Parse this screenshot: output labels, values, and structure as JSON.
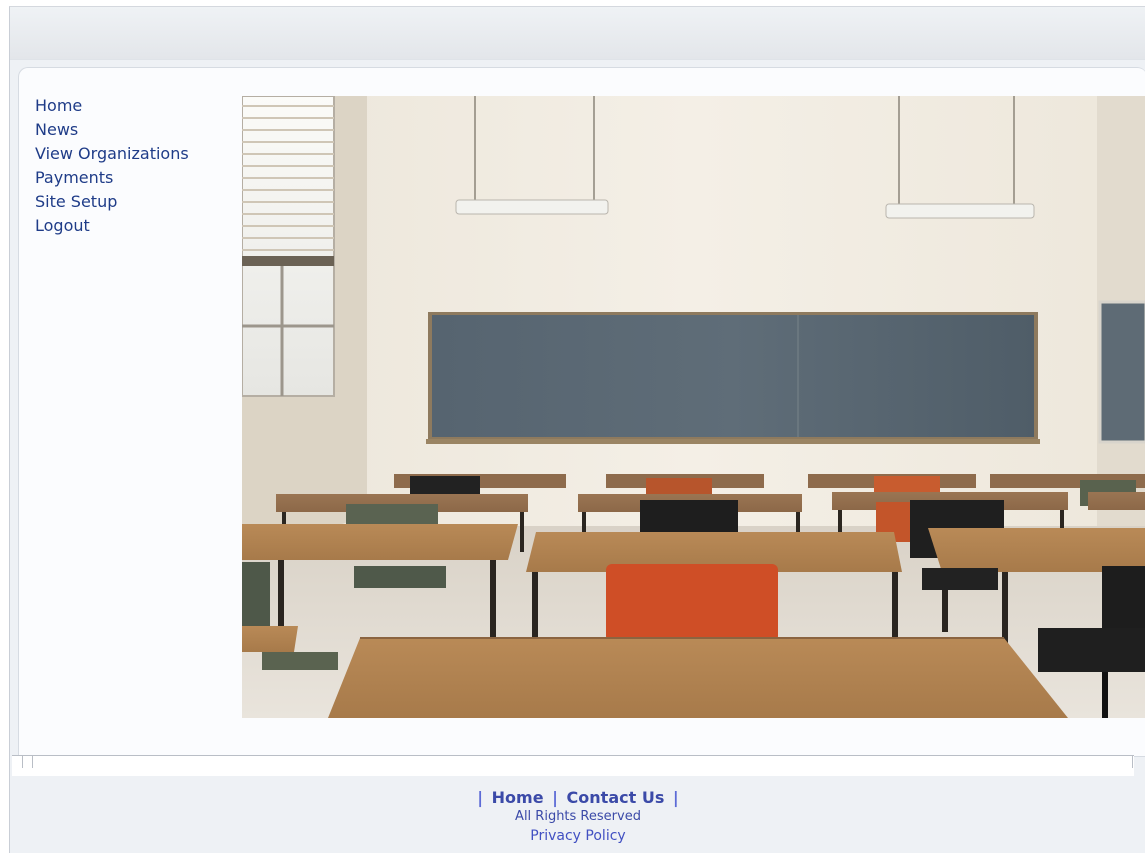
{
  "nav": {
    "items": [
      {
        "label": "Home"
      },
      {
        "label": "News"
      },
      {
        "label": "View Organizations"
      },
      {
        "label": "Payments"
      },
      {
        "label": "Site Setup"
      },
      {
        "label": "Logout"
      }
    ]
  },
  "footer": {
    "separator": "|",
    "links": [
      {
        "label": "Home"
      },
      {
        "label": "Contact Us"
      }
    ],
    "rights": "All Rights Reserved",
    "privacy": "Privacy Policy"
  },
  "colors": {
    "nav_link": "#1f3c88",
    "footer_link": "#3b4aa8",
    "page_bg": "#eef1f5",
    "panel_bg": "#fbfcfe"
  }
}
